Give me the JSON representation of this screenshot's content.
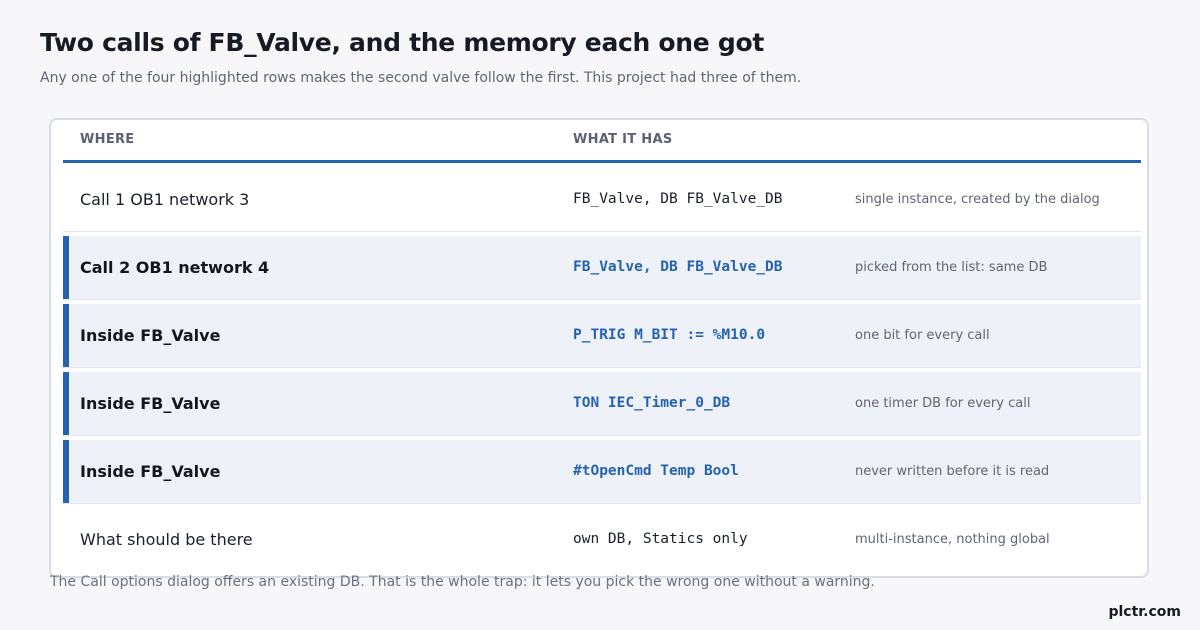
{
  "header": {
    "title": "Two calls of FB_Valve, and the memory each one got",
    "subtitle": "Any one of the four highlighted rows makes the second valve follow the first. This project had three of them."
  },
  "table": {
    "columns": [
      "WHERE",
      "WHAT IT HAS"
    ],
    "rows": [
      {
        "where": "Call 1  OB1 network 3",
        "what": "FB_Valve, DB FB_Valve_DB",
        "note": "single instance, created by the dialog",
        "highlighted": false
      },
      {
        "where": "Call 2  OB1 network 4",
        "what": "FB_Valve, DB FB_Valve_DB",
        "note": "picked from the list: same DB",
        "highlighted": true
      },
      {
        "where": "Inside FB_Valve",
        "what": "P_TRIG  M_BIT := %M10.0",
        "note": "one bit for every call",
        "highlighted": true
      },
      {
        "where": "Inside FB_Valve",
        "what": "TON  IEC_Timer_0_DB",
        "note": "one timer DB for every call",
        "highlighted": true
      },
      {
        "where": "Inside FB_Valve",
        "what": "#tOpenCmd  Temp Bool",
        "note": "never written before it is read",
        "highlighted": true
      },
      {
        "where": "What should be there",
        "what": "own DB, Statics only",
        "note": "multi-instance, nothing global",
        "highlighted": false
      }
    ]
  },
  "footnote": "The Call options dialog offers an existing DB. That is the whole trap: it lets you pick the wrong one without a warning.",
  "brand": "plctr.com",
  "colors": {
    "accent": "#2563b0",
    "highlight_row_bg": "#eef2f8",
    "background": "#f7f7f9"
  }
}
